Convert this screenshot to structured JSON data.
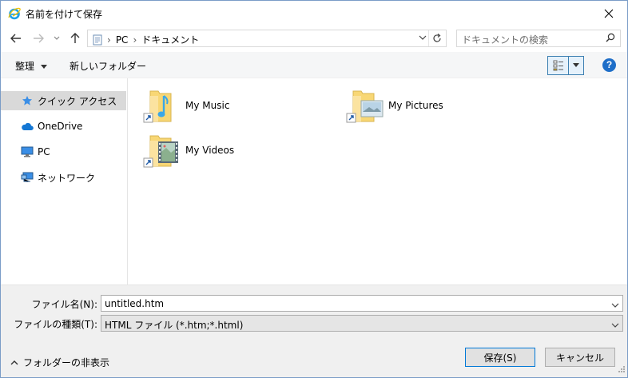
{
  "window": {
    "title": "名前を付けて保存",
    "close_glyph": "✕"
  },
  "address": {
    "crumbs": [
      "PC",
      "ドキュメント"
    ],
    "search_placeholder": "ドキュメントの検索"
  },
  "commands": {
    "organize": "整理",
    "new_folder": "新しいフォルダー",
    "help": "?"
  },
  "nav": {
    "items": [
      {
        "label": "クイック アクセス",
        "icon": "star-icon",
        "selected": true
      },
      {
        "label": "OneDrive",
        "icon": "cloud-icon",
        "selected": false
      },
      {
        "label": "PC",
        "icon": "monitor-icon",
        "selected": false
      },
      {
        "label": "ネットワーク",
        "icon": "network-icon",
        "selected": false
      }
    ]
  },
  "content": {
    "items": [
      {
        "label": "My Music",
        "icon": "music-folder-icon"
      },
      {
        "label": "My Pictures",
        "icon": "pictures-folder-icon"
      },
      {
        "label": "My Videos",
        "icon": "videos-folder-icon"
      }
    ]
  },
  "save": {
    "filename_label": "ファイル名(N):",
    "filename_value": "untitled.htm",
    "filetype_label": "ファイルの種類(T):",
    "filetype_value": "HTML ファイル (*.htm;*.html)",
    "hide_folders": "フォルダーの非表示",
    "save_button": "保存(S)",
    "cancel_button": "キャンセル"
  },
  "colors": {
    "accent": "#0078d7",
    "folder": "#f8d775",
    "help": "#1e6ec8"
  }
}
